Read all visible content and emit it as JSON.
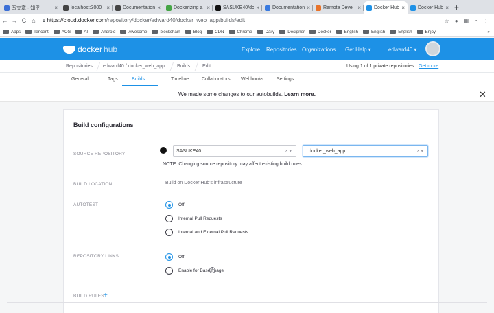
{
  "browser": {
    "tabs": [
      {
        "title": "写文章 - 知乎",
        "icon": "zhihu-icon",
        "color": "#3b6fd6"
      },
      {
        "title": "localhost:3000",
        "icon": "globe-icon",
        "color": "#444"
      },
      {
        "title": "Documentation",
        "icon": "globe-icon",
        "color": "#444"
      },
      {
        "title": "Dockerizing a",
        "icon": "green-dot-icon",
        "color": "#46a546"
      },
      {
        "title": "SASUKE40/do",
        "icon": "github-icon",
        "color": "#111"
      },
      {
        "title": "Documentation",
        "icon": "docs-icon",
        "color": "#3a7be0"
      },
      {
        "title": "Remote Devel",
        "icon": "grid-icon",
        "color": "#e8732a"
      },
      {
        "title": "Docker Hub",
        "icon": "docker-icon",
        "color": "#1d91e6"
      },
      {
        "title": "Docker Hub",
        "icon": "docker-icon",
        "color": "#1d91e6"
      }
    ],
    "new_tab": "+",
    "url_host": "https://cloud.docker.com",
    "url_path": "/repository/docker/edward40/docker_web_app/builds/edit",
    "bookmarks": [
      "Apps",
      "Tencent",
      "ACG",
      "AI",
      "Android",
      "Awesome",
      "blockchain",
      "Blog",
      "CDN",
      "Chrome",
      "Daily",
      "Designer",
      "Docker",
      "English",
      "English",
      "English",
      "Enjoy"
    ],
    "bookmarks_more": "»"
  },
  "docker_nav": {
    "logo_main": "docker",
    "logo_sub": "hub",
    "links": [
      "Explore",
      "Repositories",
      "Organizations",
      "Get Help ▾",
      "edward40 ▾"
    ]
  },
  "breadcrumb": {
    "items": [
      "Repositories",
      "edward40 / docker_web_app",
      "Builds",
      "Edit"
    ],
    "usage": "Using 1 of 1 private repositories.",
    "usage_link": "Get more"
  },
  "repo_tabs": [
    "General",
    "Tags",
    "Builds",
    "Timeline",
    "Collaborators",
    "Webhooks",
    "Settings"
  ],
  "banner": {
    "text": "We made some changes to our autobuilds.",
    "link": "Learn more."
  },
  "card": {
    "title": "Build configurations",
    "source_label": "SOURCE REPOSITORY",
    "source_org": "SASUKE40",
    "source_repo": "docker_web_app",
    "source_note": "NOTE: Changing source repository may affect existing build rules.",
    "location_label": "BUILD LOCATION",
    "location_value": "Build on Docker Hub's infrastructure",
    "autotest_label": "AUTOTEST",
    "autotest_options": [
      "Off",
      "Internal Pull Requests",
      "Internal and External Pull Requests"
    ],
    "autotest_selected": 0,
    "links_label": "REPOSITORY LINKS",
    "links_options": [
      "Off",
      "Enable for Base Image"
    ],
    "links_selected": 0,
    "rules_label": "BUILD RULES",
    "clear_glyph": "× ▾"
  },
  "colors": {
    "accent": "#1d91e6"
  }
}
